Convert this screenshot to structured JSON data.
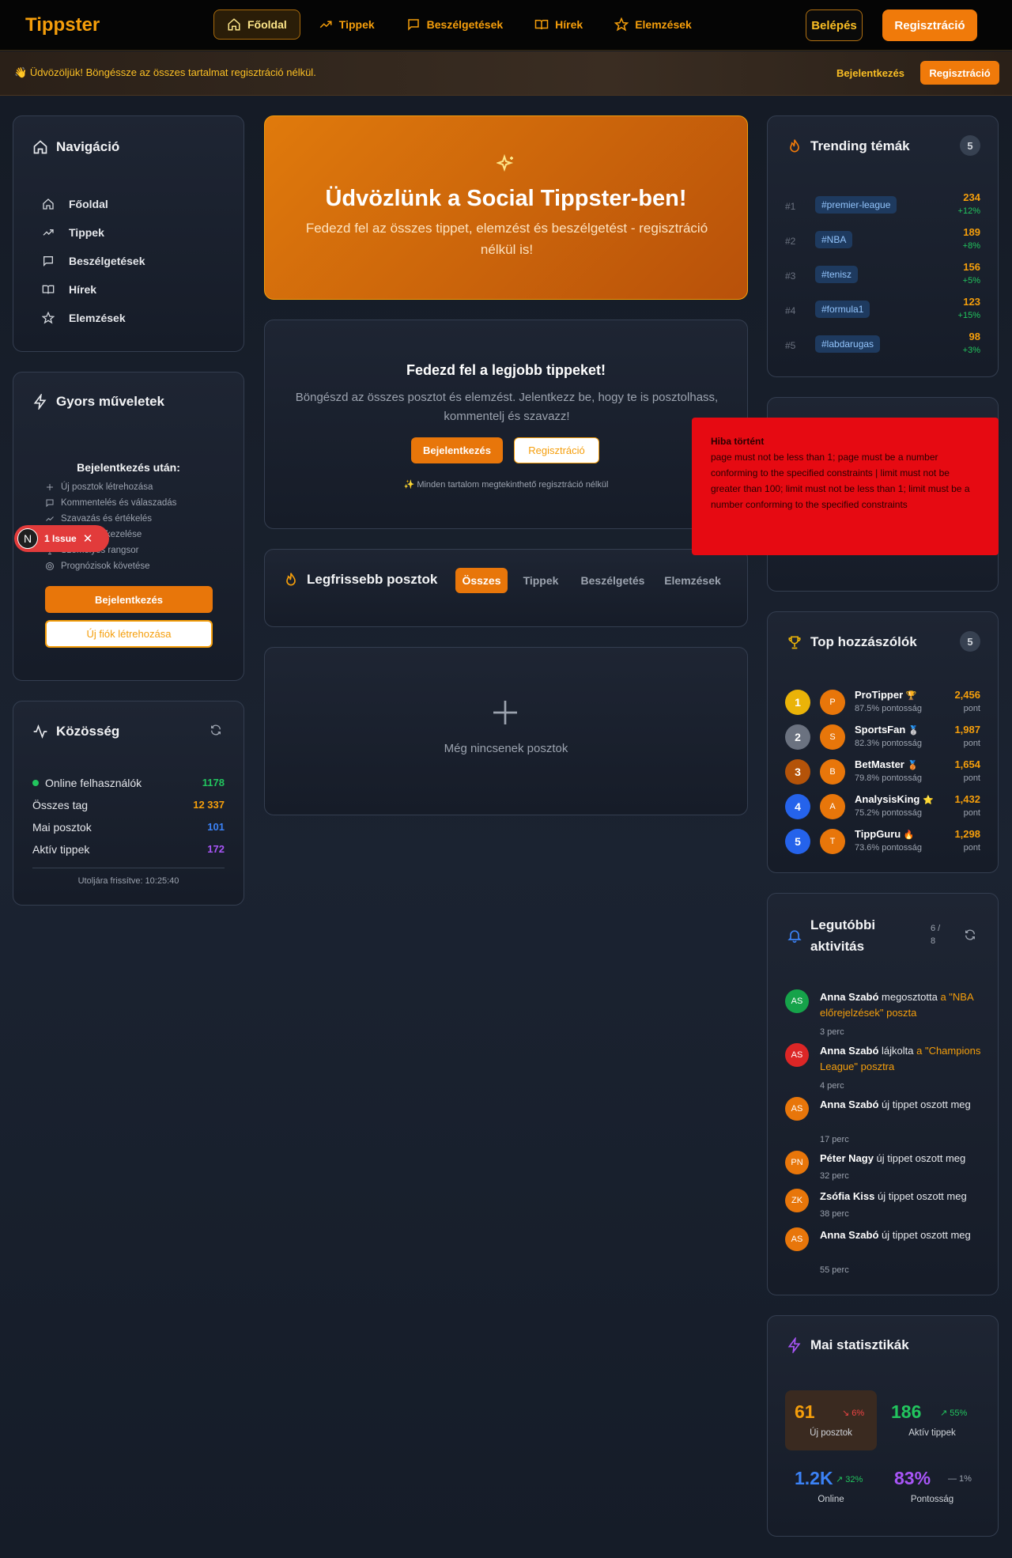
{
  "header": {
    "logo": "Tippster",
    "nav": [
      "Főoldal",
      "Tippek",
      "Beszélgetések",
      "Hírek",
      "Elemzések"
    ],
    "login": "Belépés",
    "register": "Regisztráció"
  },
  "banner": {
    "emoji": "👋",
    "text": "Üdvözöljük! Böngéssze az összes tartalmat regisztráció nélkül.",
    "login": "Bejelentkezés",
    "register": "Regisztráció"
  },
  "sidebar": {
    "nav_title": "Navigáció",
    "nav_items": [
      "Főoldal",
      "Tippek",
      "Beszélgetések",
      "Hírek",
      "Elemzések"
    ],
    "quick_title": "Gyors műveletek",
    "quick_head": "Bejelentkezés után:",
    "quick_items": [
      "Új posztok létrehozása",
      "Kommentelés és válaszadás",
      "Szavazás és értékelés",
      "Követések kezelése",
      "Személyes rangsor",
      "Prognózisok követése"
    ],
    "quick_login": "Bejelentkezés",
    "quick_register": "Új fiók létrehozása",
    "community_title": "Közösség",
    "community": [
      {
        "label": "Online felhasználók",
        "value": "1178"
      },
      {
        "label": "Összes tag",
        "value": "12 337"
      },
      {
        "label": "Mai posztok",
        "value": "101"
      },
      {
        "label": "Aktív tippek",
        "value": "172"
      }
    ],
    "community_footer": "Utoljára frissítve: 10:25:40"
  },
  "issue": {
    "letter": "N",
    "label": "1 Issue"
  },
  "hero": {
    "title": "Üdvözlünk a Social Tippster-ben!",
    "subtitle": "Fedezd fel az összes tippet, elemzést és beszélgetést - regisztráció nélkül is!"
  },
  "discover": {
    "title": "Fedezd fel a legjobb tippeket!",
    "text": "Böngészd az összes posztot és elemzést. Jelentkezz be, hogy te is posztolhass, kommentelj és szavazz!",
    "login": "Bejelentkezés",
    "register": "Regisztráció",
    "note": "✨ Minden tartalom megtekinthető regisztráció nélkül"
  },
  "posts": {
    "title": "Legfrissebb posztok",
    "tabs": [
      "Összes",
      "Tippek",
      "Beszélgetés",
      "Elemzések"
    ],
    "empty": "Még nincsenek posztok"
  },
  "trending": {
    "title": "Trending témák",
    "count": "5",
    "items": [
      {
        "rank": "#1",
        "tag": "#premier-league",
        "value": "234",
        "pct": "+12%"
      },
      {
        "rank": "#2",
        "tag": "#NBA",
        "value": "189",
        "pct": "+8%"
      },
      {
        "rank": "#3",
        "tag": "#tenisz",
        "value": "156",
        "pct": "+5%"
      },
      {
        "rank": "#4",
        "tag": "#formula1",
        "value": "123",
        "pct": "+15%"
      },
      {
        "rank": "#5",
        "tag": "#labdarugas",
        "value": "98",
        "pct": "+3%"
      }
    ]
  },
  "error": {
    "title": "Hiba történt",
    "message": "page must not be less than 1; page must be a number conforming to the specified constraints | limit must not be greater than 100; limit must not be less than 1; limit must be a number conforming to the specified constraints"
  },
  "contributors": {
    "title": "Top hozzászólók",
    "count": "5",
    "items": [
      {
        "rank": "1",
        "initial": "P",
        "name": "ProTipper",
        "medal": "🏆",
        "accuracy": "87.5% pontosság",
        "points": "2,456",
        "unit": "pont",
        "color": "#eab308"
      },
      {
        "rank": "2",
        "initial": "S",
        "name": "SportsFan",
        "medal": "🥈",
        "accuracy": "82.3% pontosság",
        "points": "1,987",
        "unit": "pont",
        "color": "#6b7280"
      },
      {
        "rank": "3",
        "initial": "B",
        "name": "BetMaster",
        "medal": "🥉",
        "accuracy": "79.8% pontosság",
        "points": "1,654",
        "unit": "pont",
        "color": "#b45309"
      },
      {
        "rank": "4",
        "initial": "A",
        "name": "AnalysisKing",
        "medal": "⭐",
        "accuracy": "75.2% pontosság",
        "points": "1,432",
        "unit": "pont",
        "color": "#2563eb"
      },
      {
        "rank": "5",
        "initial": "T",
        "name": "TippGuru",
        "medal": "🔥",
        "accuracy": "73.6% pontosság",
        "points": "1,298",
        "unit": "pont",
        "color": "#2563eb"
      }
    ]
  },
  "activity": {
    "title": "Legutóbbi aktivitás",
    "count": "6 / 8",
    "items": [
      {
        "initials": "AS",
        "user": "Anna Szabó",
        "action": " megosztotta ",
        "link": "a \"NBA előrejelzések\" poszta",
        "time": "3 perc",
        "color": "#16a34a"
      },
      {
        "initials": "AS",
        "user": "Anna Szabó",
        "action": " lájkolta ",
        "link": "a \"Champions League\" posztra",
        "time": "4 perc",
        "color": "#dc2626"
      },
      {
        "initials": "AS",
        "user": "Anna Szabó",
        "action": " új tippet oszott meg",
        "link": "",
        "time": "17 perc",
        "color": "#e8760a"
      },
      {
        "initials": "PN",
        "user": "Péter Nagy",
        "action": " új tippet oszott meg",
        "link": "",
        "time": "32 perc",
        "color": "#e8760a"
      },
      {
        "initials": "ZK",
        "user": "Zsófia Kiss",
        "action": " új tippet oszott meg",
        "link": "",
        "time": "38 perc",
        "color": "#e8760a"
      },
      {
        "initials": "AS",
        "user": "Anna Szabó",
        "action": " új tippet oszott meg",
        "link": "",
        "time": "55 perc",
        "color": "#e8760a"
      }
    ]
  },
  "stats": {
    "title": "Mai statisztikák",
    "items": [
      {
        "value": "61",
        "trend": "↘ 6%",
        "label": "Új posztok",
        "color": "#f59e0b",
        "trend_color": "#ef4444"
      },
      {
        "value": "186",
        "trend": "↗ 55%",
        "label": "Aktív tippek",
        "color": "#22c55e",
        "trend_color": "#22c55e"
      },
      {
        "value": "1.2K",
        "trend": "↗ 32%",
        "label": "Online",
        "color": "#3b82f6",
        "trend_color": "#22c55e"
      },
      {
        "value": "83%",
        "trend": "— 1%",
        "label": "Pontosság",
        "color": "#a855f7",
        "trend_color": "#9ca3af"
      }
    ]
  }
}
